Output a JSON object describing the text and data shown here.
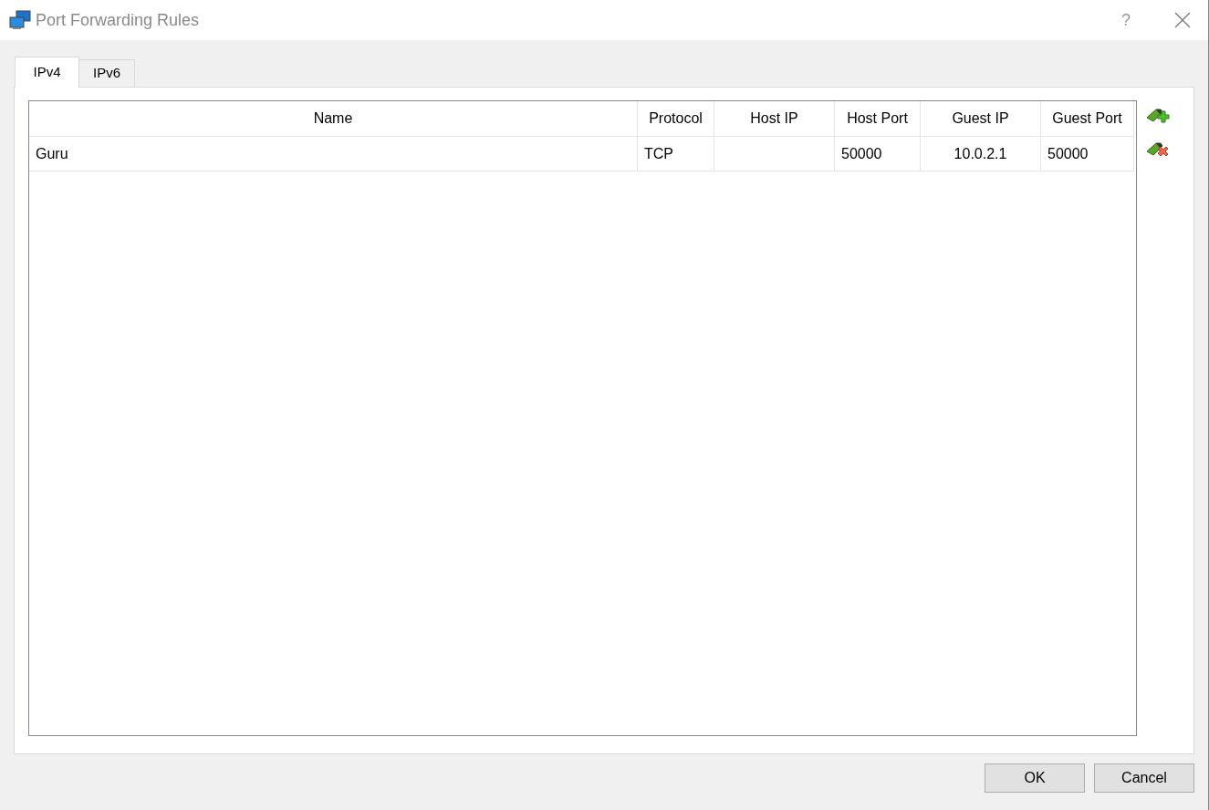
{
  "window": {
    "title": "Port Forwarding Rules",
    "help": "?"
  },
  "tabs": [
    {
      "label": "IPv4",
      "selected": true
    },
    {
      "label": "IPv6",
      "selected": false
    }
  ],
  "table": {
    "columns": [
      "Name",
      "Protocol",
      "Host IP",
      "Host Port",
      "Guest IP",
      "Guest Port"
    ],
    "rows": [
      {
        "selected": false,
        "cells": [
          "Guru",
          "TCP",
          "",
          "50000",
          "10.0.2.1",
          "50000"
        ]
      }
    ]
  },
  "buttons": [
    "OK",
    "Cancel"
  ]
}
